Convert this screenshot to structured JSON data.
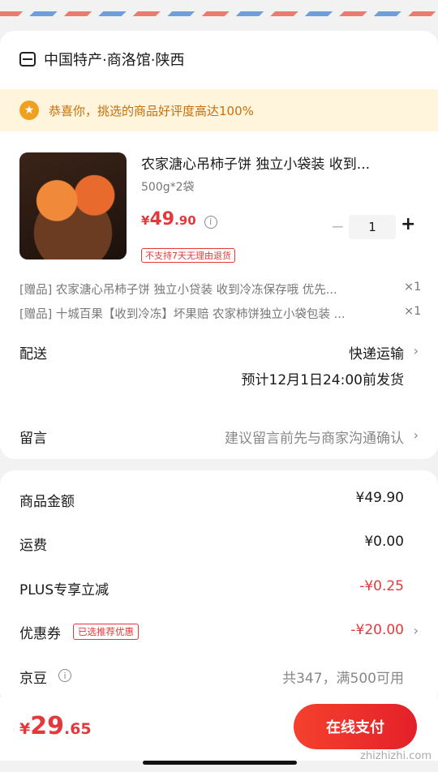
{
  "shop": {
    "name": "中国特产·商洛馆·陕西"
  },
  "banner": {
    "text": "恭喜你，挑选的商品好评度高达100%"
  },
  "product": {
    "title": "农家溏心吊柿子饼 独立小袋装 收到...",
    "spec": "500g*2袋",
    "price_symbol": "¥",
    "price_int": "49",
    "price_dec": ".90",
    "quantity": "1",
    "minus": "−",
    "plus": "+",
    "tag": "不支持7天无理由退货"
  },
  "gifts": [
    {
      "text": "[赠品] 农家溏心吊柿子饼 独立小贷装 收到冷冻保存哦 优先...",
      "qty": "×1"
    },
    {
      "text": "[赠品] 十城百果【收到冷冻】坏果赔 农家柿饼独立小袋包装 ...",
      "qty": "×1"
    }
  ],
  "delivery": {
    "label": "配送",
    "method": "快递运输",
    "eta": "预计12月1日24:00前发货"
  },
  "message": {
    "label": "留言",
    "placeholder": "建议留言前先与商家沟通确认"
  },
  "summary": {
    "goods_label": "商品金额",
    "goods_value": "¥49.90",
    "shipping_label": "运费",
    "shipping_value": "¥0.00",
    "plus_label": "PLUS专享立减",
    "plus_value": "-¥0.25",
    "coupon_label": "优惠券",
    "coupon_tag": "已选推荐优惠",
    "coupon_value": "-¥20.00",
    "jd_label": "京豆",
    "jd_value": "共347，满500可用"
  },
  "footer": {
    "total_symbol": "¥",
    "total_int": "29",
    "total_dec": ".65",
    "submit_label": "在线支付"
  },
  "watermark": "zhizhizhi.com",
  "icons": {
    "chevron": "›",
    "info": "i",
    "thumb": "👍"
  },
  "colors": {
    "accent": "#e4393c",
    "banner_bg": "#fff4dc",
    "banner_text": "#c7700c"
  }
}
